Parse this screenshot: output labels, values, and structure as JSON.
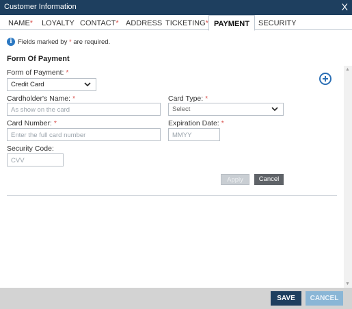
{
  "window": {
    "title": "Customer Information",
    "close_label": "X"
  },
  "tabs": [
    {
      "label": "NAME",
      "required": "*"
    },
    {
      "label": "LOYALTY",
      "required": ""
    },
    {
      "label": "CONTACT",
      "required": "*"
    },
    {
      "label": "ADDRESS",
      "required": ""
    },
    {
      "label": "TICKETING",
      "required": "*"
    },
    {
      "label": "PAYMENT",
      "required": ""
    },
    {
      "label": "SECURITY",
      "required": ""
    }
  ],
  "active_tab": "PAYMENT",
  "note": {
    "prefix": "Fields marked by",
    "star": "*",
    "suffix": "are required."
  },
  "section": {
    "title": "Form Of Payment"
  },
  "form": {
    "form_of_payment": {
      "label": "Form of Payment:",
      "star": "*",
      "value": "Credit Card"
    },
    "cardholder_name": {
      "label": "Cardholder's Name:",
      "star": "*",
      "placeholder": "As show on the card"
    },
    "card_type": {
      "label": "Card Type:",
      "star": "*",
      "value": "Select"
    },
    "card_number": {
      "label": "Card Number:",
      "star": "*",
      "placeholder": "Enter the full card number"
    },
    "expiration_date": {
      "label": "Expiration Date:",
      "star": "*",
      "placeholder": "MMYY"
    },
    "security_code": {
      "label": "Security Code:",
      "placeholder": "CVV"
    }
  },
  "buttons": {
    "apply": "Apply",
    "cancel": "Cancel",
    "save": "SAVE",
    "cancel_main": "CANCEL"
  },
  "icons": {
    "add": "add-circle-icon",
    "info": "info-icon",
    "chevron": "chevron-down-icon",
    "close": "close-icon"
  },
  "colors": {
    "title_bar": "#1e3f5f",
    "required": "#d9534f",
    "accent": "#2b6fb5",
    "cancel_main": "#8ab6d6"
  }
}
